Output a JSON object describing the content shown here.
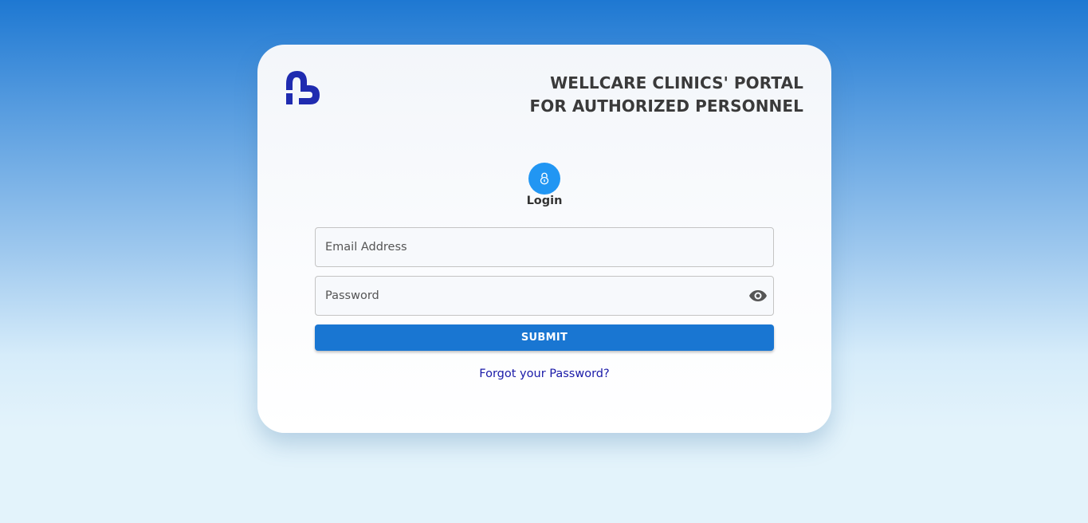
{
  "header": {
    "logo_icon": "clinic-heart-logo",
    "title_line1": "WELLCARE CLINICS' PORTAL",
    "title_line2": "FOR AUTHORIZED PERSONNEL"
  },
  "login": {
    "icon": "lock-icon",
    "label": "Login"
  },
  "form": {
    "email_placeholder": "Email Address",
    "email_value": "",
    "password_placeholder": "Password",
    "password_value": "",
    "visibility_icon": "eye-icon",
    "submit_label": "SUBMIT",
    "forgot_label": "Forgot your Password?"
  },
  "colors": {
    "accent": "#1976d2",
    "lock_circle": "#2196f3",
    "logo": "#1f2bb0",
    "link": "#1a1aa8"
  }
}
